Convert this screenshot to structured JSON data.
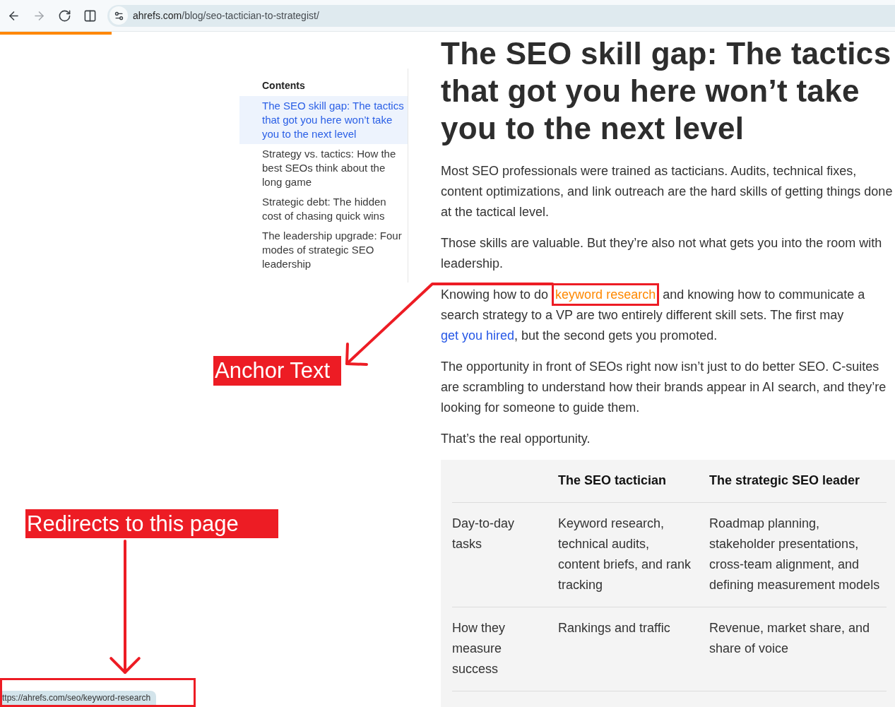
{
  "browser": {
    "nav_buttons": [
      {
        "kind": "back",
        "disabled": false
      },
      {
        "kind": "forward",
        "disabled": true
      },
      {
        "kind": "reload",
        "disabled": false
      },
      {
        "kind": "split",
        "disabled": false
      }
    ],
    "address": {
      "host": "ahrefs.com",
      "path": "/blog/seo-tactician-to-strategist/"
    },
    "status_url": "ttps://ahrefs.com/seo/keyword-research"
  },
  "reading_progress": {
    "level": 0.125
  },
  "contents": {
    "title": "Contents",
    "items": [
      {
        "label": "The SEO skill gap: The tactics that got you here won’t take you to the next level",
        "selected": true
      },
      {
        "label": "Strategy vs. tactics: How the best SEOs think about the long game",
        "selected": false
      },
      {
        "label": "Strategic debt: The hidden cost of chasing quick wins",
        "selected": false
      },
      {
        "label": "The leadership upgrade: Four modes of strategic SEO leadership",
        "selected": false
      }
    ]
  },
  "article": {
    "title": "The SEO skill gap: The tactics that got you here won’t take you to the next level",
    "paragraphs": [
      {
        "segments": [
          {
            "kind": "text",
            "text": "Most SEO professionals were trained as tacticians. Audits, technical fixes, content optimizations, and link outreach are the hard skills of getting things done at the tactical level."
          }
        ]
      },
      {
        "segments": [
          {
            "kind": "text",
            "text": "Those skills are valuable. But they’re also not what gets you into the room with leadership."
          }
        ]
      },
      {
        "segments": [
          {
            "kind": "text",
            "text": "Knowing how to do "
          },
          {
            "kind": "link",
            "text": "keyword research",
            "hovered": true
          },
          {
            "kind": "text",
            "text": " and knowing how to communicate a search strategy to a VP are two entirely different skill sets. The first may "
          },
          {
            "kind": "link",
            "text": "get you hired",
            "hovered": false
          },
          {
            "kind": "text",
            "text": ", but the second gets you promoted."
          }
        ]
      },
      {
        "segments": [
          {
            "kind": "text",
            "text": "The opportunity in front of SEOs right now isn’t just to do better SEO. C-suites are scrambling to understand how their brands appear in AI search, and they’re looking for someone to guide them."
          }
        ]
      },
      {
        "segments": [
          {
            "kind": "text",
            "text": "That’s the real opportunity."
          }
        ]
      }
    ],
    "table": {
      "columns": [
        "The SEO tactician",
        "The strategic SEO leader"
      ],
      "rows": [
        {
          "label": "Day-to-day tasks",
          "cells": [
            "Keyword research, technical audits, content briefs, and rank tracking",
            "Roadmap planning, stakeholder presentations, cross-team alignment, and defining measurement models"
          ]
        },
        {
          "label": "How they measure success",
          "cells": [
            "Rankings and traffic",
            "Revenue, market share, and share of voice"
          ]
        }
      ]
    }
  },
  "annotations": [
    {
      "kind": "anchor_label",
      "text": "Anchor Text"
    },
    {
      "kind": "redirect_label",
      "text": "Redirects to this page"
    }
  ]
}
